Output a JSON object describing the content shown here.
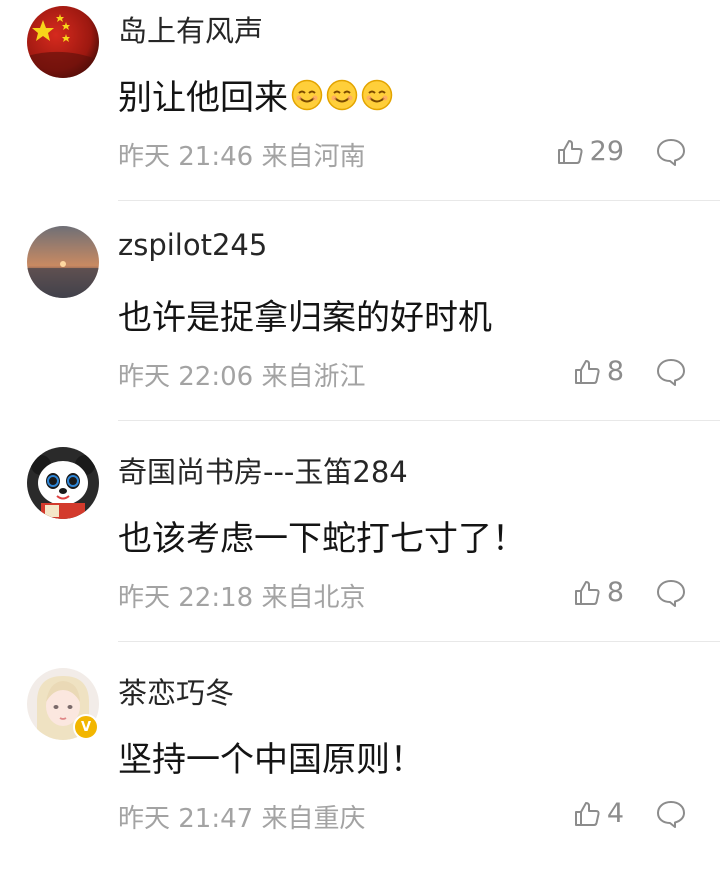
{
  "comments": [
    {
      "username": "岛上有风声",
      "text": "别让他回来",
      "emojis": [
        "smile-emoji",
        "smile-emoji",
        "smile-emoji"
      ],
      "time": "昨天 21:46",
      "location": "来自河南",
      "likes": "29",
      "avatar": "flag-avatar"
    },
    {
      "username": "zspilot245",
      "text": "也许是捉拿归案的好时机",
      "time": "昨天 22:06",
      "location": "来自浙江",
      "likes": "8",
      "avatar": "sunset-sea-avatar"
    },
    {
      "username": "奇国尚书房---玉笛284",
      "text": "也该考虑一下蛇打七寸了！",
      "time": "昨天 22:18",
      "location": "来自北京",
      "likes": "8",
      "avatar": "panda-avatar"
    },
    {
      "username": "茶恋巧冬",
      "text": "坚持一个中国原则！",
      "time": "昨天 21:47",
      "location": "来自重庆",
      "likes": "4",
      "avatar": "girl-avatar",
      "verified_badge": "V"
    }
  ],
  "colors": {
    "meta": "#a3a3a3",
    "divider": "#e8e8e8",
    "badge": "#f2b600"
  }
}
